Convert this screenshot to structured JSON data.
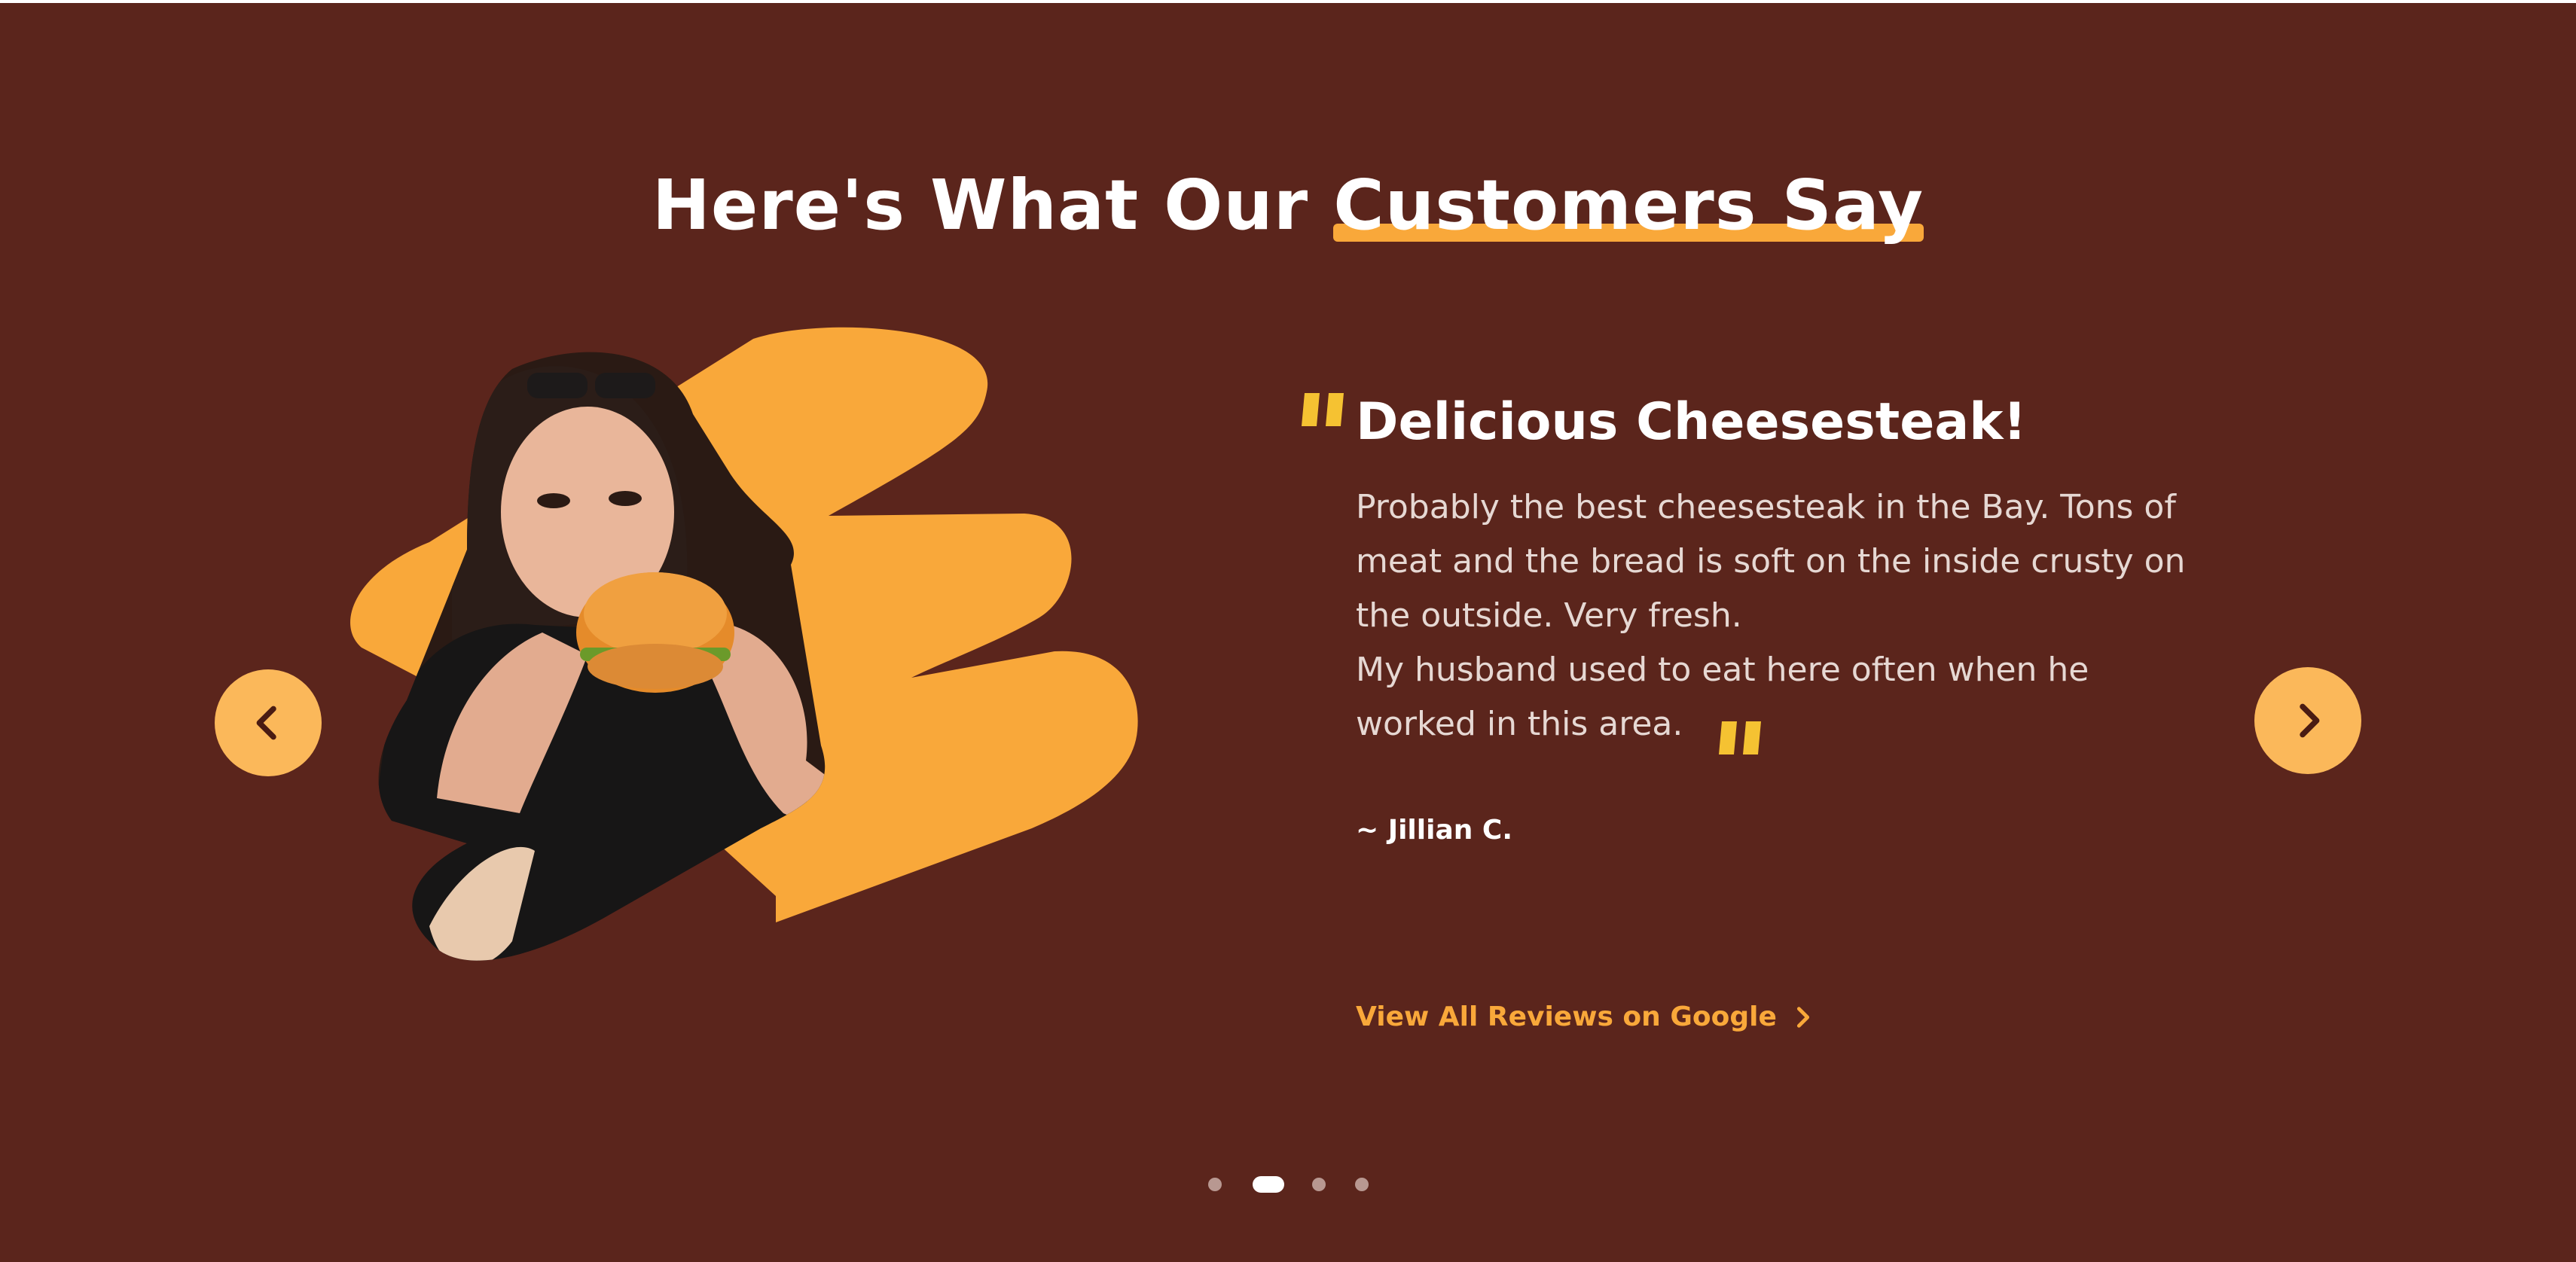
{
  "heading": {
    "part1": "Here's What Our ",
    "part2": "Customers Say"
  },
  "testimonial": {
    "title": "Delicious Cheesesteak!",
    "lines": [
      "Probably the best cheesesteak in the Bay. Tons of meat and the bread is soft on the inside crusty on the outside. Very fresh.",
      "My husband used to eat here often when he worked in this area."
    ],
    "author": "~ Jillian C.",
    "image": "woman-eating-burger-photo"
  },
  "link": {
    "label": "View All Reviews on Google",
    "icon": "chevron-right-icon"
  },
  "navigation": {
    "prev_icon": "chevron-left-icon",
    "next_icon": "chevron-right-icon"
  },
  "pagination": {
    "count": 4,
    "active_index": 1
  },
  "colors": {
    "background": "#5b251c",
    "accent": "#f9a83a",
    "quote": "#f5c232",
    "button": "#fbb85a",
    "icon_dark": "#4a1b12",
    "text": "#ffffff",
    "body_text": "#e6d8d3"
  }
}
